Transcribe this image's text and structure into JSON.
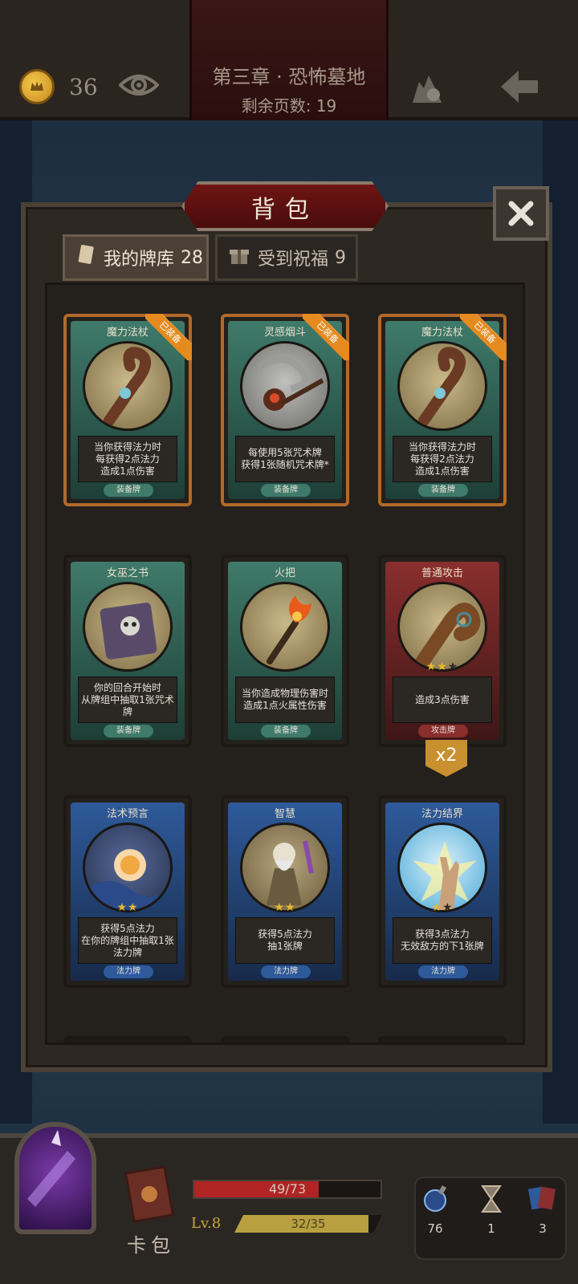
{
  "header": {
    "chapter_title": "第三章 · 恐怖墓地",
    "pages_left": "剩余页数: 19",
    "coins": "36",
    "icons": [
      "coin-icon",
      "eye-icon",
      "bag-icon",
      "back-arrow-icon"
    ]
  },
  "panel": {
    "title": "背包",
    "tabs": [
      {
        "label": "我的牌库",
        "count": "28"
      },
      {
        "label": "受到祝福",
        "count": "9"
      }
    ]
  },
  "badge_equipped": "已装备",
  "cards": [
    {
      "name": "魔力法杖",
      "desc": [
        "当你获得法力时",
        "每获得2点法力",
        "造成1点伤害"
      ],
      "type": "装备牌",
      "equipped": true,
      "color": "green",
      "stars": null
    },
    {
      "name": "灵感烟斗",
      "desc": [
        "每使用5张咒术牌",
        "获得1张随机咒术牌*"
      ],
      "type": "装备牌",
      "equipped": true,
      "color": "green",
      "stars": null
    },
    {
      "name": "魔力法杖",
      "desc": [
        "当你获得法力时",
        "每获得2点法力",
        "造成1点伤害"
      ],
      "type": "装备牌",
      "equipped": true,
      "color": "green",
      "stars": null
    },
    {
      "name": "女巫之书",
      "desc": [
        "你的回合开始时",
        "从牌组中抽取1张咒术牌"
      ],
      "type": "装备牌",
      "equipped": false,
      "color": "green",
      "stars": null
    },
    {
      "name": "火把",
      "desc": [
        "当你造成物理伤害时",
        "造成1点火属性伤害"
      ],
      "type": "装备牌",
      "equipped": false,
      "color": "green",
      "stars": null
    },
    {
      "name": "普通攻击",
      "desc": [
        "造成3点伤害"
      ],
      "type": "攻击牌",
      "equipped": false,
      "color": "red",
      "stars": 2
    },
    {
      "name": "法术预言",
      "desc": [
        "获得5点法力",
        "在你的牌组中抽取1张",
        "法力牌"
      ],
      "type": "法力牌",
      "equipped": false,
      "color": "blue",
      "stars": 2
    },
    {
      "name": "智慧",
      "desc": [
        "获得5点法力",
        "抽1张牌"
      ],
      "type": "法力牌",
      "equipped": false,
      "color": "blue",
      "stars": 2
    },
    {
      "name": "法力结界",
      "desc": [
        "获得3点法力",
        "无效敌方的下1张牌"
      ],
      "type": "法力牌",
      "equipped": false,
      "color": "blue",
      "stars": 1
    }
  ],
  "multiplier": "x2",
  "hud": {
    "deck_label": "卡包",
    "hp": "49/73",
    "hp_ratio": 0.67,
    "level": "Lv.8",
    "xp": "32/35",
    "xp_ratio": 0.91,
    "potions": "76",
    "hourglass": "1",
    "cards": "3"
  },
  "colors": {
    "green_card": "#3f7a6a",
    "red_card": "#8a2e2e",
    "blue_card": "#2e5a9a",
    "equipped_badge": "#e58a1f",
    "hp": "#b02424",
    "xp": "#b8a040"
  }
}
